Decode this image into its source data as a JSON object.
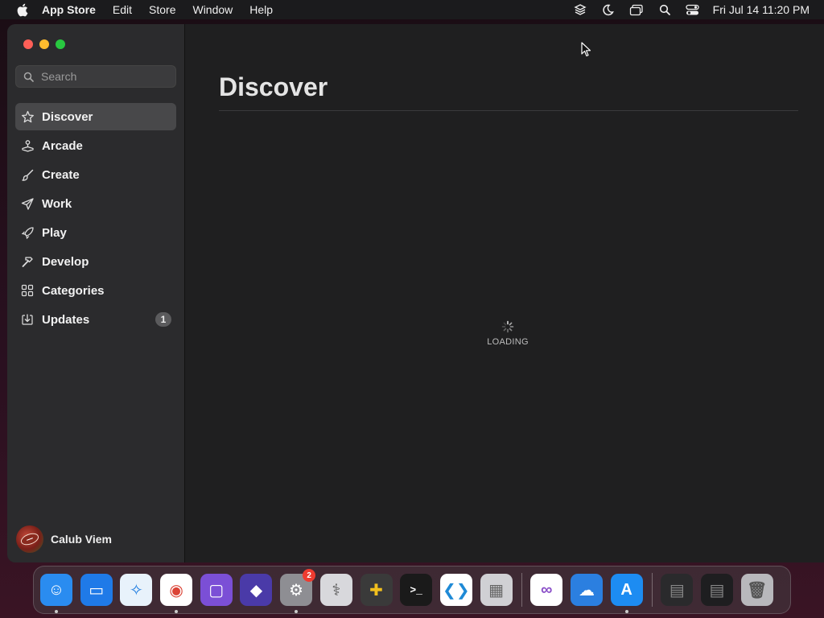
{
  "menubar": {
    "app_name": "App Store",
    "items": [
      "Edit",
      "Store",
      "Window",
      "Help"
    ],
    "clock": "Fri Jul 14  11:20 PM"
  },
  "sidebar": {
    "search_placeholder": "Search",
    "items": [
      {
        "label": "Discover",
        "icon": "star-icon",
        "active": true
      },
      {
        "label": "Arcade",
        "icon": "joystick-icon"
      },
      {
        "label": "Create",
        "icon": "brush-icon"
      },
      {
        "label": "Work",
        "icon": "paperplane-icon"
      },
      {
        "label": "Play",
        "icon": "rocket-icon"
      },
      {
        "label": "Develop",
        "icon": "hammer-icon"
      },
      {
        "label": "Categories",
        "icon": "grid-icon"
      },
      {
        "label": "Updates",
        "icon": "download-icon",
        "badge": "1"
      }
    ],
    "profile": {
      "name": "Calub Viem"
    }
  },
  "main": {
    "title": "Discover",
    "loading_text": "LOADING"
  },
  "dock": {
    "apps": [
      {
        "name": "Finder",
        "icon": "finder-icon",
        "color": "#2a8cf0"
      },
      {
        "name": "Keynote",
        "icon": "keynote-icon",
        "color": "#1f7ae8"
      },
      {
        "name": "Safari",
        "icon": "safari-icon",
        "color": "#e8f2fb"
      },
      {
        "name": "Chrome",
        "icon": "chrome-icon",
        "color": "#ffffff"
      },
      {
        "name": "Simulator",
        "icon": "simulator-icon",
        "color": "#7b4fd6"
      },
      {
        "name": "Shortcuts",
        "icon": "shortcuts-icon",
        "color": "#4a3aa8"
      },
      {
        "name": "System Settings",
        "icon": "settings-icon",
        "color": "#8e8e93",
        "badge": "2"
      },
      {
        "name": "Disk Utility",
        "icon": "diskutility-icon",
        "color": "#d8d8dc"
      },
      {
        "name": "Color Picker",
        "icon": "colorpicker-icon",
        "color": "#3a3a3a"
      },
      {
        "name": "Terminal",
        "icon": "terminal-icon",
        "color": "#1a1a1a"
      },
      {
        "name": "VS Code",
        "icon": "vscode-icon",
        "color": "#ffffff"
      },
      {
        "name": "Launchpad",
        "icon": "launchpad-icon",
        "color": "#d0d0d4"
      },
      {
        "name": "Visual Studio",
        "icon": "visualstudio-icon",
        "color": "#ffffff"
      },
      {
        "name": "Weather",
        "icon": "weather-icon",
        "color": "#2b7fe0"
      },
      {
        "name": "App Store",
        "icon": "appstore-icon",
        "color": "#1d8cf2"
      },
      {
        "name": "Window Preview 1",
        "icon": "window-thumbnail-icon",
        "color": "#2a2a2c"
      },
      {
        "name": "Window Preview 2",
        "icon": "window-thumbnail-icon",
        "color": "#1e1e20"
      },
      {
        "name": "Trash",
        "icon": "trash-icon",
        "color": "#b8b8bc"
      }
    ]
  }
}
